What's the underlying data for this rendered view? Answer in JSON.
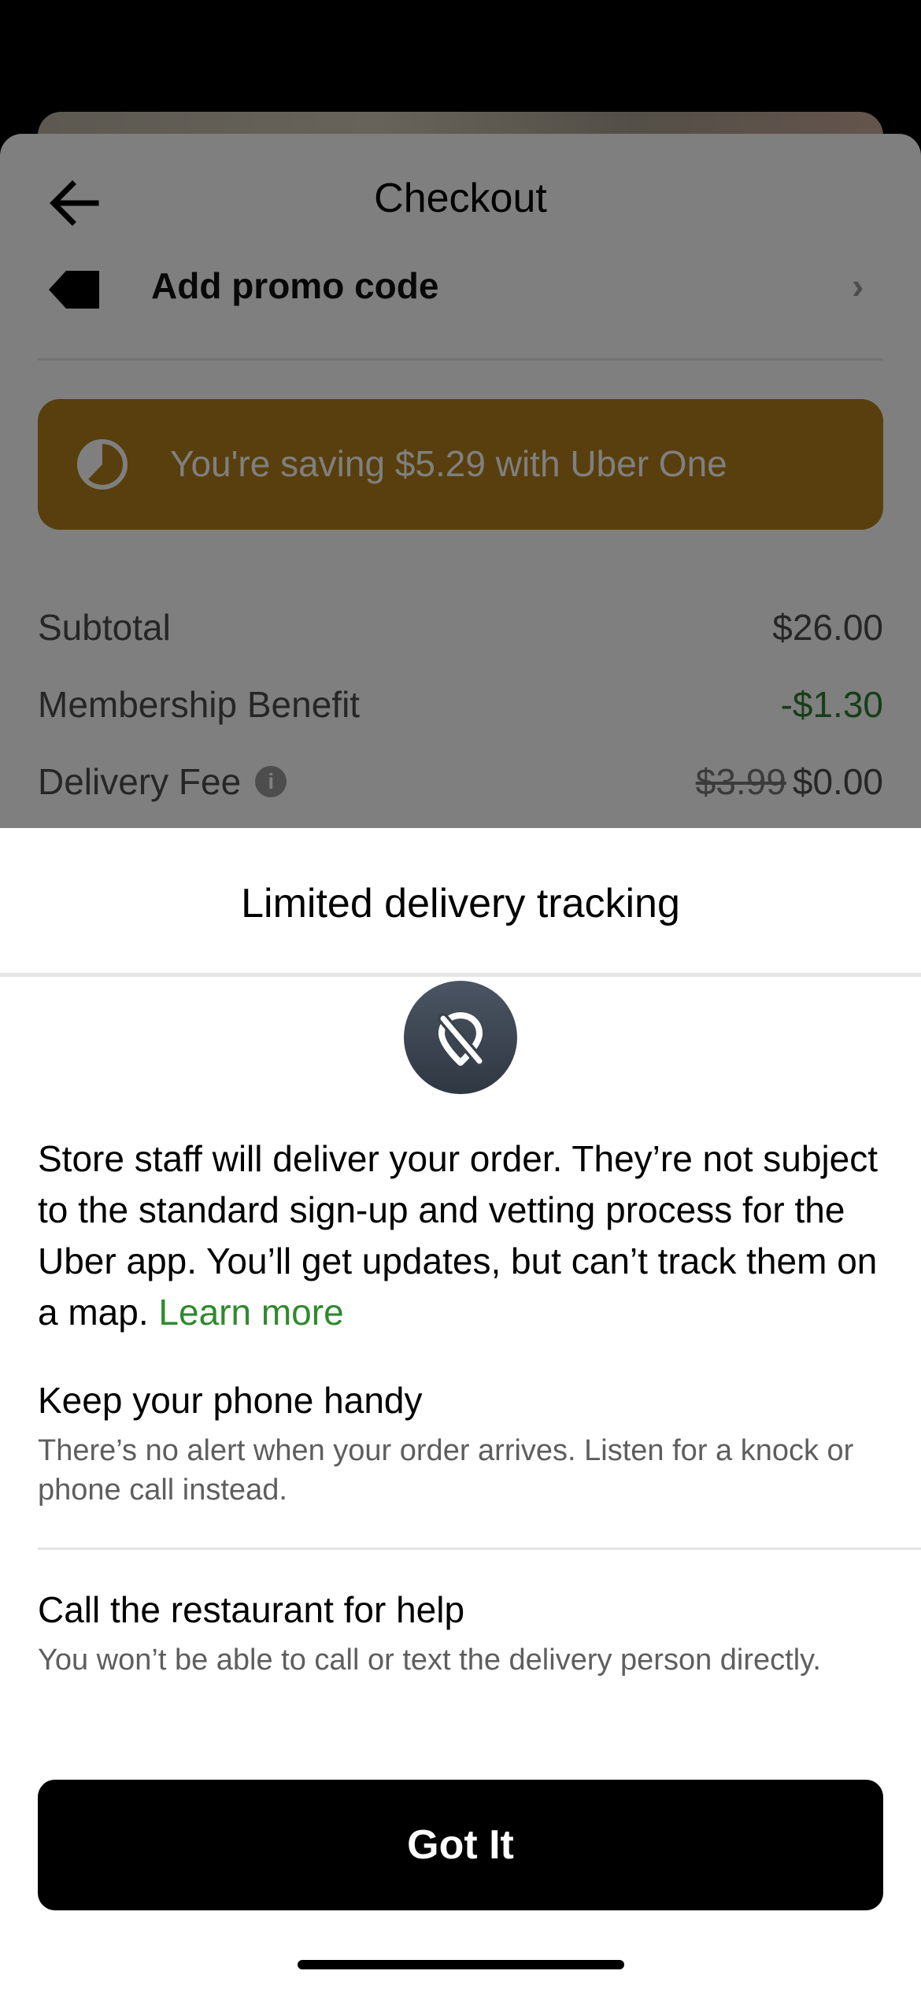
{
  "checkout": {
    "title": "Checkout",
    "promo_label": "Add promo code",
    "promo_chevron": "›",
    "uber_one_text": "You're saving $5.29 with Uber One",
    "rows": [
      {
        "label": "Subtotal",
        "value": "$26.00"
      },
      {
        "label": "Membership Benefit",
        "value": "-$1.30"
      },
      {
        "label": "Delivery Fee",
        "old_value": "$3.99",
        "value": "$0.00"
      }
    ]
  },
  "modal": {
    "title": "Limited delivery tracking",
    "description": "Store staff will deliver your order. They’re not subject to the standard sign-up and vetting process for the Uber app. You’ll get updates, but can’t track them on a map.",
    "learn_more": "Learn more",
    "sections": [
      {
        "title": "Keep your phone handy",
        "body": "There’s no alert when your order arrives. Listen for a knock or phone call instead."
      },
      {
        "title": "Call the restaurant for help",
        "body": "You won’t be able to call or text the delivery person directly."
      }
    ],
    "button_label": "Got It"
  },
  "icons": {
    "back": "arrow-left-icon",
    "promo": "tag-icon",
    "uber_one": "uber-one-icon",
    "info": "info-icon",
    "tracking_off": "location-off-icon"
  },
  "colors": {
    "accent_green": "#2f8a2e",
    "uber_one_gold": "#b07f1a",
    "button_black": "#000000"
  }
}
